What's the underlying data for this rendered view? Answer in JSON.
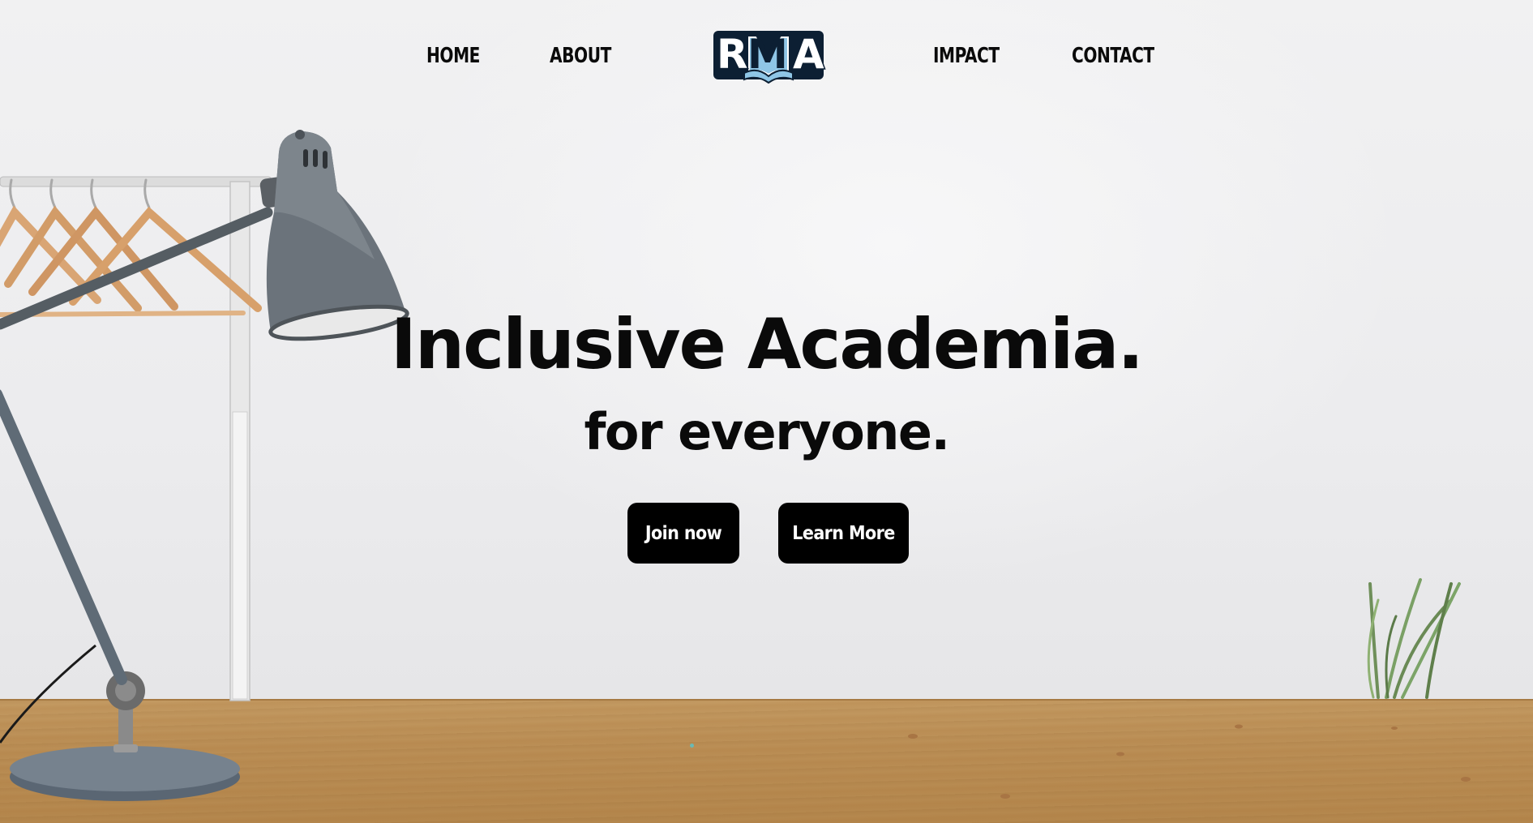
{
  "nav": {
    "home_label": "HOME",
    "about_label": "ABOUT",
    "impact_label": "IMPACT",
    "contact_label": "CONTACT"
  },
  "logo": {
    "letters": [
      "R",
      "M",
      "A"
    ]
  },
  "hero": {
    "title": "Inclusive Academia.",
    "subtitle": "for everyone.",
    "join_label": "Join now",
    "learn_label": "Learn More"
  },
  "colors": {
    "text": "#0a0a0a",
    "button_bg": "#000000",
    "button_text": "#ffffff",
    "logo_dark": "#0c1f33",
    "logo_accent": "#8fc6e6"
  },
  "icons": {
    "logo": "open-book-logo-icon"
  }
}
